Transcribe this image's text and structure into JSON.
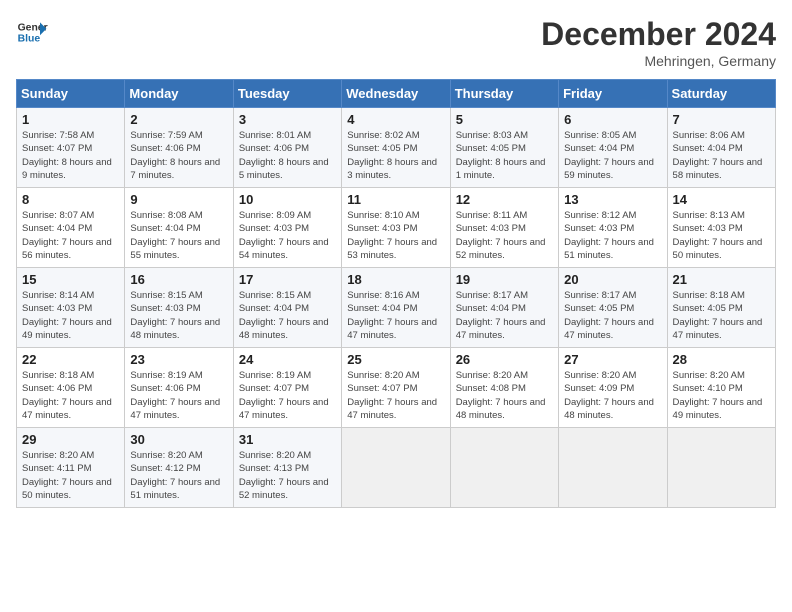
{
  "logo": {
    "line1": "General",
    "line2": "Blue"
  },
  "header": {
    "month": "December 2024",
    "location": "Mehringen, Germany"
  },
  "weekdays": [
    "Sunday",
    "Monday",
    "Tuesday",
    "Wednesday",
    "Thursday",
    "Friday",
    "Saturday"
  ],
  "weeks": [
    [
      {
        "day": "1",
        "sunrise": "Sunrise: 7:58 AM",
        "sunset": "Sunset: 4:07 PM",
        "daylight": "Daylight: 8 hours and 9 minutes."
      },
      {
        "day": "2",
        "sunrise": "Sunrise: 7:59 AM",
        "sunset": "Sunset: 4:06 PM",
        "daylight": "Daylight: 8 hours and 7 minutes."
      },
      {
        "day": "3",
        "sunrise": "Sunrise: 8:01 AM",
        "sunset": "Sunset: 4:06 PM",
        "daylight": "Daylight: 8 hours and 5 minutes."
      },
      {
        "day": "4",
        "sunrise": "Sunrise: 8:02 AM",
        "sunset": "Sunset: 4:05 PM",
        "daylight": "Daylight: 8 hours and 3 minutes."
      },
      {
        "day": "5",
        "sunrise": "Sunrise: 8:03 AM",
        "sunset": "Sunset: 4:05 PM",
        "daylight": "Daylight: 8 hours and 1 minute."
      },
      {
        "day": "6",
        "sunrise": "Sunrise: 8:05 AM",
        "sunset": "Sunset: 4:04 PM",
        "daylight": "Daylight: 7 hours and 59 minutes."
      },
      {
        "day": "7",
        "sunrise": "Sunrise: 8:06 AM",
        "sunset": "Sunset: 4:04 PM",
        "daylight": "Daylight: 7 hours and 58 minutes."
      }
    ],
    [
      {
        "day": "8",
        "sunrise": "Sunrise: 8:07 AM",
        "sunset": "Sunset: 4:04 PM",
        "daylight": "Daylight: 7 hours and 56 minutes."
      },
      {
        "day": "9",
        "sunrise": "Sunrise: 8:08 AM",
        "sunset": "Sunset: 4:04 PM",
        "daylight": "Daylight: 7 hours and 55 minutes."
      },
      {
        "day": "10",
        "sunrise": "Sunrise: 8:09 AM",
        "sunset": "Sunset: 4:03 PM",
        "daylight": "Daylight: 7 hours and 54 minutes."
      },
      {
        "day": "11",
        "sunrise": "Sunrise: 8:10 AM",
        "sunset": "Sunset: 4:03 PM",
        "daylight": "Daylight: 7 hours and 53 minutes."
      },
      {
        "day": "12",
        "sunrise": "Sunrise: 8:11 AM",
        "sunset": "Sunset: 4:03 PM",
        "daylight": "Daylight: 7 hours and 52 minutes."
      },
      {
        "day": "13",
        "sunrise": "Sunrise: 8:12 AM",
        "sunset": "Sunset: 4:03 PM",
        "daylight": "Daylight: 7 hours and 51 minutes."
      },
      {
        "day": "14",
        "sunrise": "Sunrise: 8:13 AM",
        "sunset": "Sunset: 4:03 PM",
        "daylight": "Daylight: 7 hours and 50 minutes."
      }
    ],
    [
      {
        "day": "15",
        "sunrise": "Sunrise: 8:14 AM",
        "sunset": "Sunset: 4:03 PM",
        "daylight": "Daylight: 7 hours and 49 minutes."
      },
      {
        "day": "16",
        "sunrise": "Sunrise: 8:15 AM",
        "sunset": "Sunset: 4:03 PM",
        "daylight": "Daylight: 7 hours and 48 minutes."
      },
      {
        "day": "17",
        "sunrise": "Sunrise: 8:15 AM",
        "sunset": "Sunset: 4:04 PM",
        "daylight": "Daylight: 7 hours and 48 minutes."
      },
      {
        "day": "18",
        "sunrise": "Sunrise: 8:16 AM",
        "sunset": "Sunset: 4:04 PM",
        "daylight": "Daylight: 7 hours and 47 minutes."
      },
      {
        "day": "19",
        "sunrise": "Sunrise: 8:17 AM",
        "sunset": "Sunset: 4:04 PM",
        "daylight": "Daylight: 7 hours and 47 minutes."
      },
      {
        "day": "20",
        "sunrise": "Sunrise: 8:17 AM",
        "sunset": "Sunset: 4:05 PM",
        "daylight": "Daylight: 7 hours and 47 minutes."
      },
      {
        "day": "21",
        "sunrise": "Sunrise: 8:18 AM",
        "sunset": "Sunset: 4:05 PM",
        "daylight": "Daylight: 7 hours and 47 minutes."
      }
    ],
    [
      {
        "day": "22",
        "sunrise": "Sunrise: 8:18 AM",
        "sunset": "Sunset: 4:06 PM",
        "daylight": "Daylight: 7 hours and 47 minutes."
      },
      {
        "day": "23",
        "sunrise": "Sunrise: 8:19 AM",
        "sunset": "Sunset: 4:06 PM",
        "daylight": "Daylight: 7 hours and 47 minutes."
      },
      {
        "day": "24",
        "sunrise": "Sunrise: 8:19 AM",
        "sunset": "Sunset: 4:07 PM",
        "daylight": "Daylight: 7 hours and 47 minutes."
      },
      {
        "day": "25",
        "sunrise": "Sunrise: 8:20 AM",
        "sunset": "Sunset: 4:07 PM",
        "daylight": "Daylight: 7 hours and 47 minutes."
      },
      {
        "day": "26",
        "sunrise": "Sunrise: 8:20 AM",
        "sunset": "Sunset: 4:08 PM",
        "daylight": "Daylight: 7 hours and 48 minutes."
      },
      {
        "day": "27",
        "sunrise": "Sunrise: 8:20 AM",
        "sunset": "Sunset: 4:09 PM",
        "daylight": "Daylight: 7 hours and 48 minutes."
      },
      {
        "day": "28",
        "sunrise": "Sunrise: 8:20 AM",
        "sunset": "Sunset: 4:10 PM",
        "daylight": "Daylight: 7 hours and 49 minutes."
      }
    ],
    [
      {
        "day": "29",
        "sunrise": "Sunrise: 8:20 AM",
        "sunset": "Sunset: 4:11 PM",
        "daylight": "Daylight: 7 hours and 50 minutes."
      },
      {
        "day": "30",
        "sunrise": "Sunrise: 8:20 AM",
        "sunset": "Sunset: 4:12 PM",
        "daylight": "Daylight: 7 hours and 51 minutes."
      },
      {
        "day": "31",
        "sunrise": "Sunrise: 8:20 AM",
        "sunset": "Sunset: 4:13 PM",
        "daylight": "Daylight: 7 hours and 52 minutes."
      },
      null,
      null,
      null,
      null
    ]
  ]
}
